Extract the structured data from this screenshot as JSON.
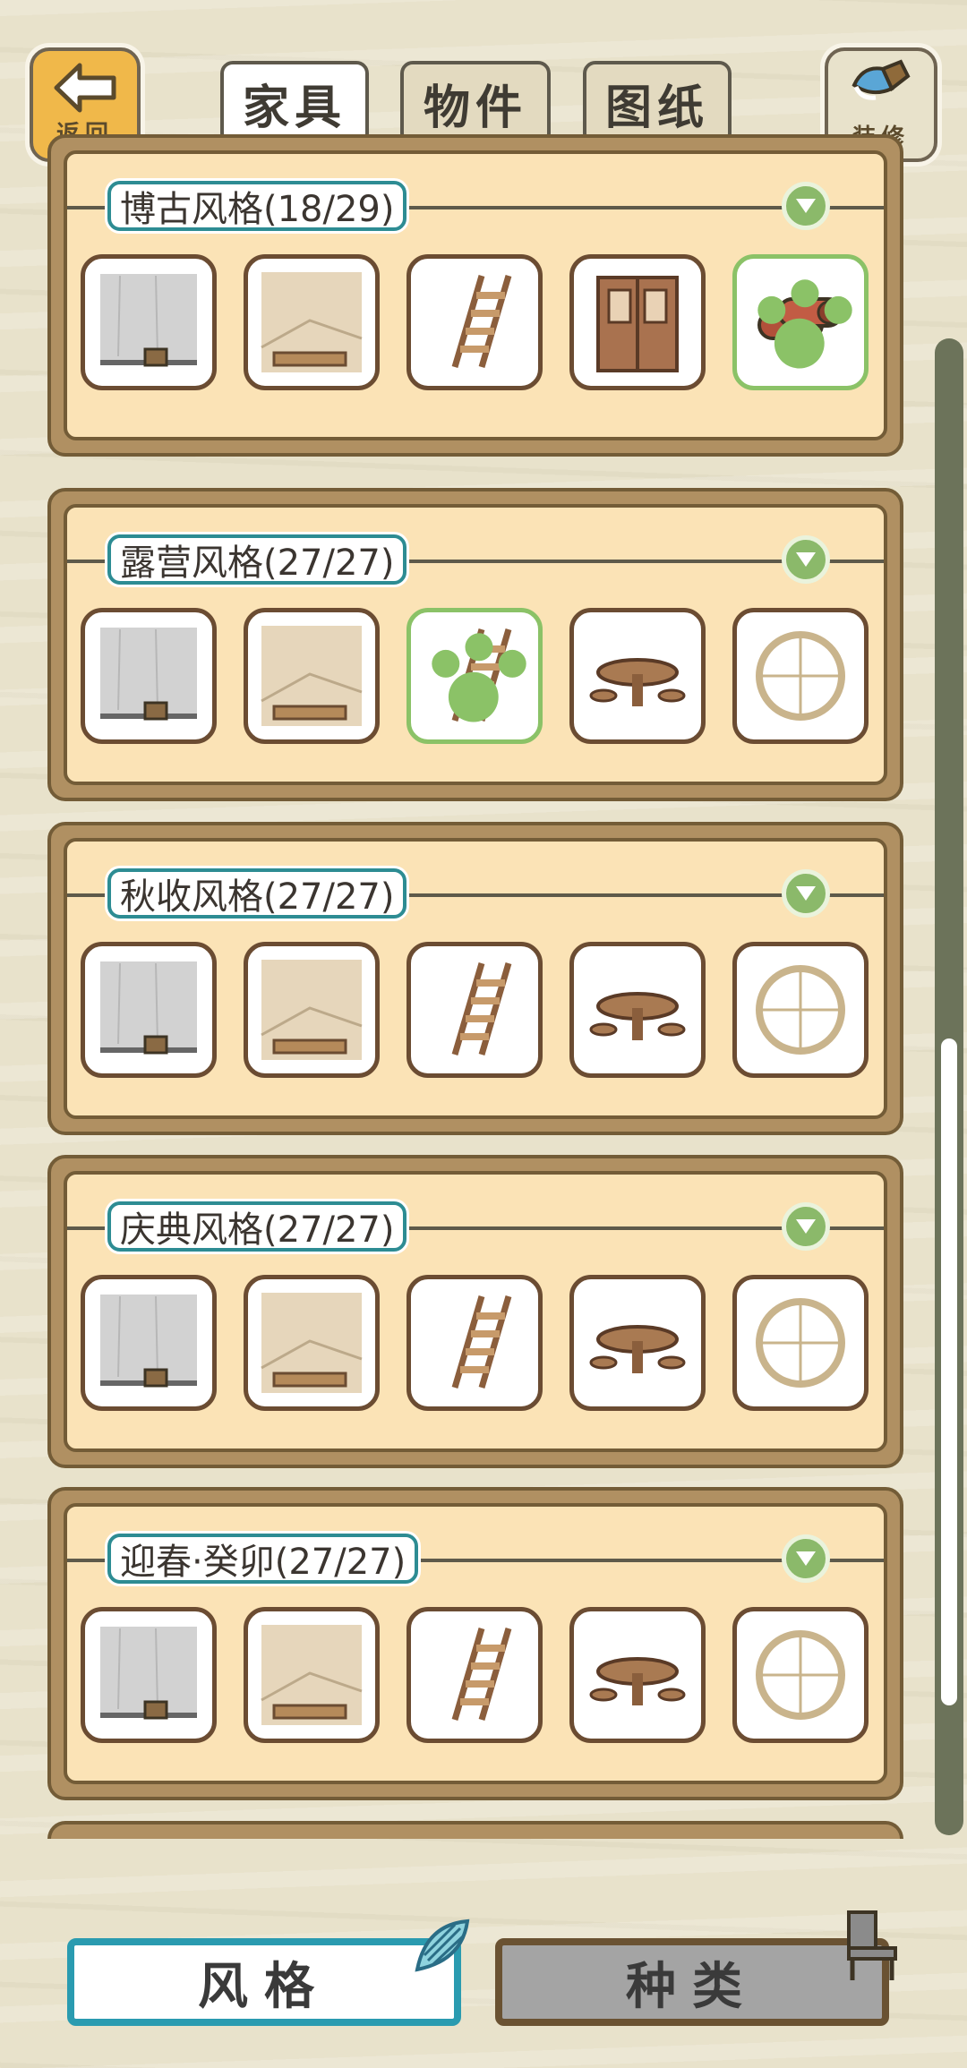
{
  "header": {
    "back": {
      "label": "返回"
    },
    "tabs": [
      {
        "label": "家具",
        "active": true
      },
      {
        "label": "物件",
        "active": false
      },
      {
        "label": "图纸",
        "active": false
      }
    ],
    "decorate": {
      "label": "装修"
    }
  },
  "sections": [
    {
      "title": "博古风格(18/29)",
      "items": [
        "wall-item",
        "floor-item",
        "ladder-item",
        "door-item",
        "rolls-item"
      ],
      "selected_index": 4
    },
    {
      "title": "露营风格(27/27)",
      "items": [
        "wall-item",
        "floor-item",
        "ladder-item",
        "table-item",
        "window-item"
      ],
      "selected_index": 2
    },
    {
      "title": "秋收风格(27/27)",
      "items": [
        "wall-item",
        "floor-item",
        "ladder-item",
        "table-item",
        "window-item"
      ],
      "selected_index": -1
    },
    {
      "title": "庆典风格(27/27)",
      "items": [
        "wall-item",
        "floor-item",
        "ladder-item",
        "table-item",
        "window-item"
      ],
      "selected_index": -1
    },
    {
      "title": "迎春·癸卯(27/27)",
      "items": [
        "wall-item",
        "floor-item",
        "ladder-item",
        "table-item",
        "window-item"
      ],
      "selected_index": -1
    }
  ],
  "bottom_tabs": [
    {
      "label": "风格",
      "active": true,
      "icon": "shell-icon"
    },
    {
      "label": "种类",
      "active": false,
      "icon": "chair-icon"
    }
  ],
  "colors": {
    "accent": "#2a9bb0",
    "select": "#8bc267",
    "panel": "#b09062",
    "panel_inner": "#fbe3b6"
  }
}
